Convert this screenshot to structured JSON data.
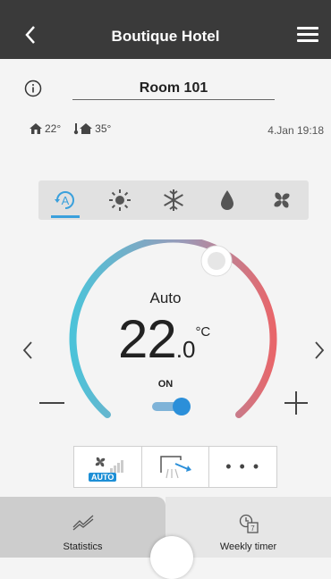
{
  "header": {
    "title": "Boutique Hotel"
  },
  "room": {
    "name": "Room 101"
  },
  "status": {
    "indoor_temp": "22°",
    "outdoor_temp": "35°",
    "datetime": "4.Jan 19:18"
  },
  "modes": [
    {
      "name": "auto-mode-icon",
      "selected": true
    },
    {
      "name": "heat-mode-icon",
      "selected": false
    },
    {
      "name": "cool-mode-icon",
      "selected": false
    },
    {
      "name": "dry-mode-icon",
      "selected": false
    },
    {
      "name": "fan-mode-icon",
      "selected": false
    }
  ],
  "control": {
    "mode_label": "Auto",
    "setpoint_int": "22",
    "setpoint_dec": ".0",
    "unit": "°C",
    "power_label": "ON",
    "power_on": true
  },
  "options": {
    "fan_speed_badge": "AUTO",
    "more_label": "• • •"
  },
  "bottom_tabs": {
    "statistics": "Statistics",
    "weekly_timer": "Weekly timer"
  },
  "colors": {
    "accent": "#3aa0dc",
    "arc_cool": "#4cc3d9",
    "arc_warm": "#e8666a",
    "header_bg": "#3a3a3a"
  }
}
